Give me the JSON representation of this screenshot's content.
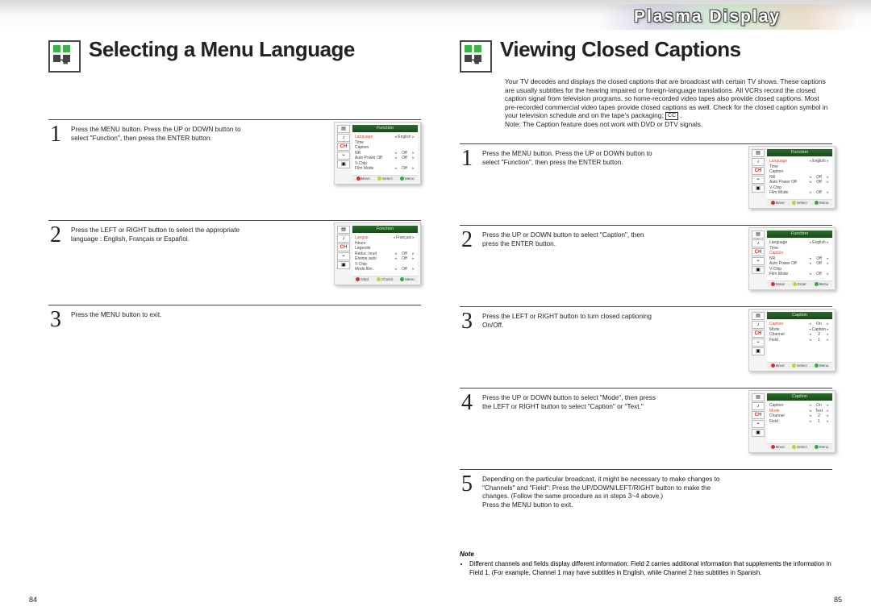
{
  "header": {
    "brand": "Plasma Display"
  },
  "pages": {
    "left": "84",
    "right": "85"
  },
  "left": {
    "title": "Selecting a Menu Language",
    "steps": {
      "s1": "Press the MENU button. Press the UP or DOWN button to select \"Function\", then press the ENTER button.",
      "s2": "Press the LEFT or RIGHT button to select the appropriate language : English, Français or Español.",
      "s3": "Press the MENU button to exit."
    },
    "shots": {
      "s1": {
        "title": "Function",
        "rows": [
          {
            "l": "Language",
            "v": "English",
            "hl": true
          },
          {
            "l": "Time",
            "v": ""
          },
          {
            "l": "Caption",
            "v": ""
          },
          {
            "l": "NR",
            "v": "Off"
          },
          {
            "l": "Auto Power Off",
            "v": "Off"
          },
          {
            "l": "V-Chip",
            "v": ""
          },
          {
            "l": "Film Mode",
            "v": "Off"
          }
        ],
        "foot": [
          "Move",
          "Select",
          "Menu"
        ]
      },
      "s2": {
        "title": "Fonction",
        "rows": [
          {
            "l": "Langue",
            "v": "Français",
            "hl": true
          },
          {
            "l": "Heure",
            "v": ""
          },
          {
            "l": "Légende",
            "v": ""
          },
          {
            "l": "Réduc. bruit",
            "v": "Off"
          },
          {
            "l": "Éteinte auto",
            "v": "Off"
          },
          {
            "l": "V-Chip",
            "v": ""
          },
          {
            "l": "Mode film",
            "v": "Off"
          }
        ],
        "foot": [
          "Dépl.",
          "Choisir",
          "Menu"
        ]
      }
    }
  },
  "right": {
    "title": "Viewing Closed Captions",
    "intro": "Your TV decodes and displays the closed captions that are broadcast with certain TV shows. These captions are usually subtitles for the hearing impaired or foreign-language translations. All VCRs record the closed caption signal from television programs, so home-recorded video tapes also provide closed captions. Most pre-recorded commercial video tapes provide closed captions as well. Check for the closed caption symbol in your television schedule and on the tape's packaging:",
    "intro_note": "Note: The Caption feature does not work with DVD or DTV signals.",
    "cc": "CC",
    "steps": {
      "s1": "Press the MENU button. Press the UP or DOWN button to select \"Function\", then press the ENTER button.",
      "s2": "Press the UP or DOWN button to select \"Caption\", then press the ENTER button.",
      "s3": "Press the LEFT or RIGHT button to turn closed captioning On/Off.",
      "s4": "Press the UP or DOWN button to select \"Mode\", then press the LEFT or RIGHT button to select \"Caption\" or \"Text.\"",
      "s5": "Depending on the particular broadcast, it might be necessary to make changes to \"Channels\" and \"Field\": Press the UP/DOWN/LEFT/RIGHT button to make the changes. (Follow the same procedure as in steps 3~4 above.)\nPress the MENU button to exit."
    },
    "shots": {
      "s1": {
        "title": "Function",
        "rows": [
          {
            "l": "Language",
            "v": "English",
            "hl": true
          },
          {
            "l": "Time",
            "v": ""
          },
          {
            "l": "Caption",
            "v": ""
          },
          {
            "l": "NR",
            "v": "Off"
          },
          {
            "l": "Auto Power Off",
            "v": "Off"
          },
          {
            "l": "V-Chip",
            "v": ""
          },
          {
            "l": "Film Mode",
            "v": "Off"
          }
        ],
        "foot": [
          "Move",
          "Select",
          "Menu"
        ]
      },
      "s2": {
        "title": "Function",
        "rows": [
          {
            "l": "Language",
            "v": "English"
          },
          {
            "l": "Time",
            "v": ""
          },
          {
            "l": "Caption",
            "v": "",
            "hl": true
          },
          {
            "l": "NR",
            "v": "Off"
          },
          {
            "l": "Auto Power Off",
            "v": "Off"
          },
          {
            "l": "V-Chip",
            "v": ""
          },
          {
            "l": "Film Mode",
            "v": "Off"
          }
        ],
        "foot": [
          "Move",
          "Enter",
          "Menu"
        ]
      },
      "s3": {
        "title": "Caption",
        "rows": [
          {
            "l": "Caption",
            "v": "On",
            "hl": true
          },
          {
            "l": "Mode",
            "v": "Caption"
          },
          {
            "l": "Channel",
            "v": "2"
          },
          {
            "l": "Field",
            "v": "1"
          }
        ],
        "foot": [
          "Move",
          "Select",
          "Menu"
        ]
      },
      "s4": {
        "title": "Caption",
        "rows": [
          {
            "l": "Caption",
            "v": "On"
          },
          {
            "l": "Mode",
            "v": "Text",
            "hl": true
          },
          {
            "l": "Channel",
            "v": "2"
          },
          {
            "l": "Field",
            "v": "1"
          }
        ],
        "foot": [
          "Move",
          "Select",
          "Menu"
        ]
      }
    },
    "note_label": "Note",
    "note_text": "Different channels and fields display different information: Field 2 carries additional information that supplements the information in Field 1. (For example, Channel 1 may have subtitles in English, while Channel 2 has subtitles in Spanish."
  }
}
